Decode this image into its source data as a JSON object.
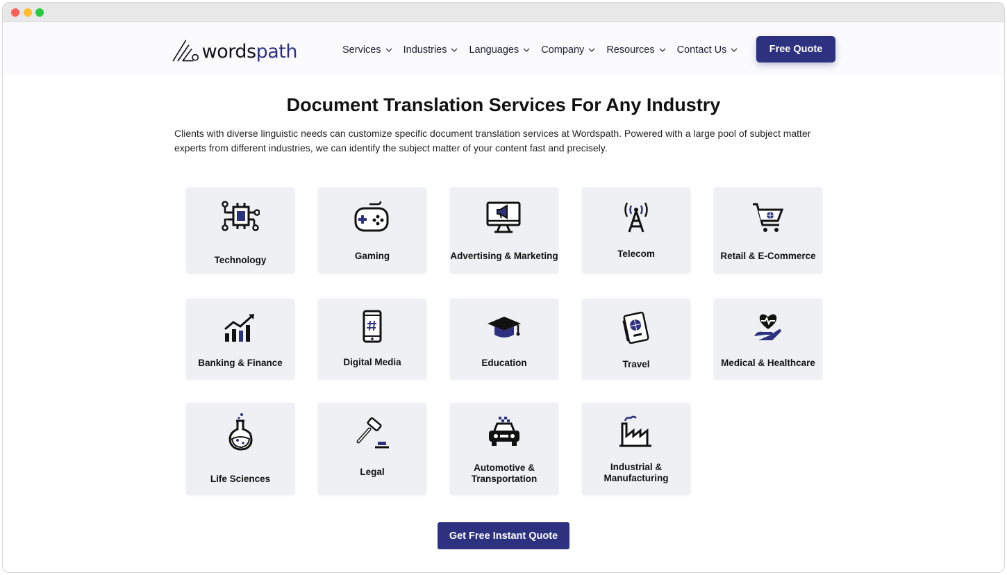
{
  "header": {
    "logo": {
      "text_main": "words",
      "text_accent": "path"
    },
    "nav": [
      {
        "label": "Services"
      },
      {
        "label": "Industries"
      },
      {
        "label": "Languages"
      },
      {
        "label": "Company"
      },
      {
        "label": "Resources"
      },
      {
        "label": "Contact Us"
      }
    ],
    "free_quote_label": "Free Quote"
  },
  "main": {
    "title": "Document Translation Services For Any Industry",
    "intro": "Clients with diverse linguistic needs can customize specific document translation services at Wordspath. Powered with a large pool of subject matter experts from different industries, we can identify the subject matter of your content fast and precisely.",
    "industries": [
      {
        "label": "Technology",
        "icon": "chip-icon"
      },
      {
        "label": "Gaming",
        "icon": "gamepad-icon"
      },
      {
        "label": "Advertising & Marketing",
        "icon": "monitor-megaphone-icon"
      },
      {
        "label": "Telecom",
        "icon": "antenna-tower-icon"
      },
      {
        "label": "Retail & E-Commerce",
        "icon": "shopping-cart-icon"
      },
      {
        "label": "Banking & Finance",
        "icon": "growth-chart-icon"
      },
      {
        "label": "Digital Media",
        "icon": "smartphone-hashtag-icon"
      },
      {
        "label": "Education",
        "icon": "graduation-cap-icon"
      },
      {
        "label": "Travel",
        "icon": "passport-icon"
      },
      {
        "label": "Medical & Healthcare",
        "icon": "heart-hand-icon"
      },
      {
        "label": "Life Sciences",
        "icon": "flask-icon"
      },
      {
        "label": "Legal",
        "icon": "gavel-icon"
      },
      {
        "label": "Automotive & Transportation",
        "icon": "taxi-icon"
      },
      {
        "label": "Industrial & Manufacturing",
        "icon": "factory-icon"
      }
    ],
    "cta_label": "Get Free Instant Quote"
  },
  "colors": {
    "brand": "#2d3180",
    "card_bg": "#eff0f4"
  }
}
